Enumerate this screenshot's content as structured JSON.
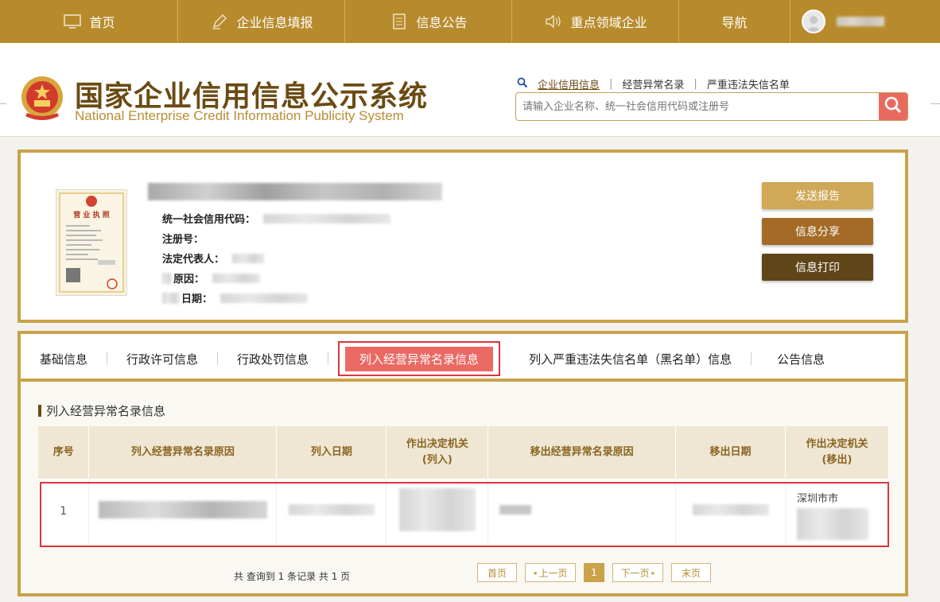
{
  "nav": {
    "items": [
      {
        "label": "首页",
        "icon": "monitor-icon"
      },
      {
        "label": "企业信息填报",
        "icon": "pen-icon"
      },
      {
        "label": "信息公告",
        "icon": "document-icon"
      },
      {
        "label": "重点领域企业",
        "icon": "speaker-icon"
      },
      {
        "label": "导航",
        "icon": ""
      }
    ],
    "avatar_icon": "user-avatar-icon"
  },
  "header": {
    "title_cn": "国家企业信用信息公示系统",
    "title_en": "National Enterprise Credit Information Publicity System",
    "search_links": [
      "企业信用信息",
      "经营异常名录",
      "严重违法失信名单"
    ],
    "search_placeholder": "请输入企业名称、统一社会信用代码或注册号",
    "search_icon": "search-icon"
  },
  "company": {
    "license_title": "营 业 执 照",
    "fields": [
      {
        "label": "统一社会信用代码："
      },
      {
        "label": "注册号："
      },
      {
        "label": "法定代表人："
      },
      {
        "label": "原因："
      },
      {
        "label": "日期："
      }
    ],
    "buttons": {
      "send_report": "发送报告",
      "share": "信息分享",
      "print": "信息打印"
    }
  },
  "tabs": [
    "基础信息",
    "行政许可信息",
    "行政处罚信息",
    "列入经营异常名录信息",
    "列入严重违法失信名单（黑名单）信息",
    "公告信息"
  ],
  "active_tab": "列入经营异常名录信息",
  "section_title": "列入经营异常名录信息",
  "table": {
    "headers": [
      "序号",
      "列入经营异常名录原因",
      "列入日期",
      "作出决定机关\n(列入)",
      "移出经营异常名录原因",
      "移出日期",
      "作出决定机关\n(移出)"
    ],
    "rows": [
      {
        "index": "1",
        "remove_authority_partial": "深圳市市"
      }
    ]
  },
  "pagination": {
    "summary": "共 查询到 1 条记录 共 1 页",
    "first": "首页",
    "prev": "上一页",
    "current": "1",
    "next": "下一页",
    "last": "末页"
  },
  "colors": {
    "nav_bg": "#b78b2c",
    "accent_gold": "#c9a24a",
    "brown_title": "#6b4b13",
    "highlight_red": "#d9363e",
    "active_tab_bg": "#ea6a63"
  }
}
